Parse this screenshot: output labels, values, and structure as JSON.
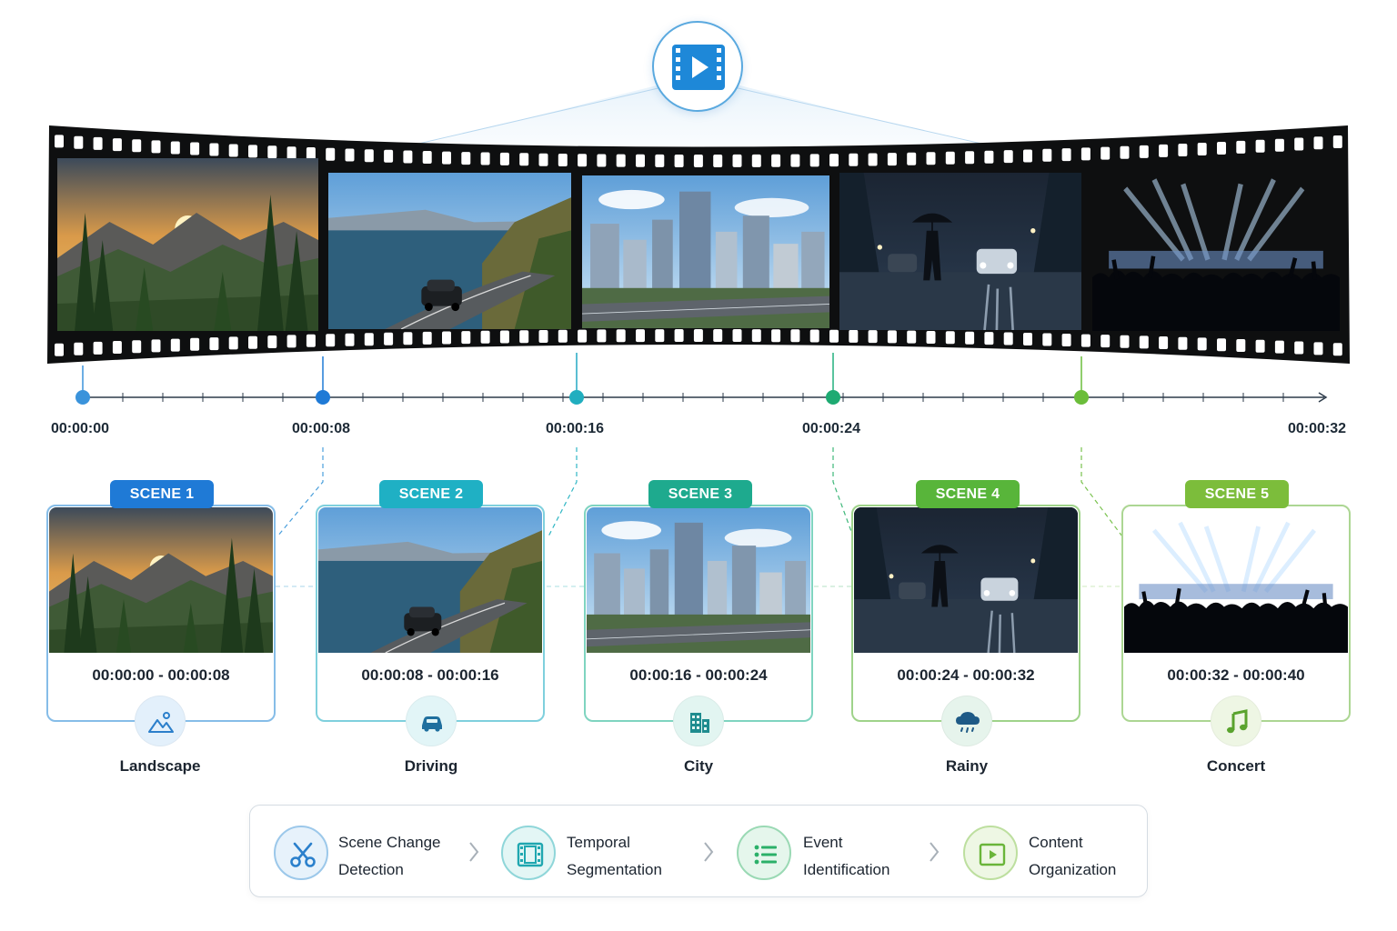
{
  "header": {
    "icon": "video-play-icon"
  },
  "timeline": {
    "ticks": [
      "00:00:00",
      "00:00:08",
      "00:00:16",
      "00:00:24",
      "00:00:32"
    ]
  },
  "scenes": [
    {
      "title": "SCENE 1",
      "range": "00:00:00 - 00:00:08",
      "label": "Landscape",
      "icon": "landscape-icon",
      "color": "#1f7ad6"
    },
    {
      "title": "SCENE 2",
      "range": "00:00:08 - 00:00:16",
      "label": "Driving",
      "icon": "car-icon",
      "color": "#21a8c0"
    },
    {
      "title": "SCENE 3",
      "range": "00:00:16 - 00:00:24",
      "label": "City",
      "icon": "building-icon",
      "color": "#1eaa8e"
    },
    {
      "title": "SCENE 4",
      "range": "00:00:24 - 00:00:32",
      "label": "Rainy",
      "icon": "rain-cloud-icon",
      "color": "#58b53a"
    },
    {
      "title": "SCENE 5",
      "range": "00:00:32 - 00:00:40",
      "label": "Concert",
      "icon": "music-note-icon",
      "color": "#7cbd3b"
    }
  ],
  "process": {
    "steps": [
      {
        "line1": "Scene Change",
        "line2": "Detection",
        "icon": "scissors-icon",
        "color": "#2b80cc"
      },
      {
        "line1": "Temporal",
        "line2": "Segmentation",
        "icon": "film-icon",
        "color": "#1fa7b0"
      },
      {
        "line1": "Event",
        "line2": "Identification",
        "icon": "list-icon",
        "color": "#2bb069"
      },
      {
        "line1": "Content",
        "line2": "Organization",
        "icon": "play-frame-icon",
        "color": "#6ab53a"
      }
    ]
  }
}
